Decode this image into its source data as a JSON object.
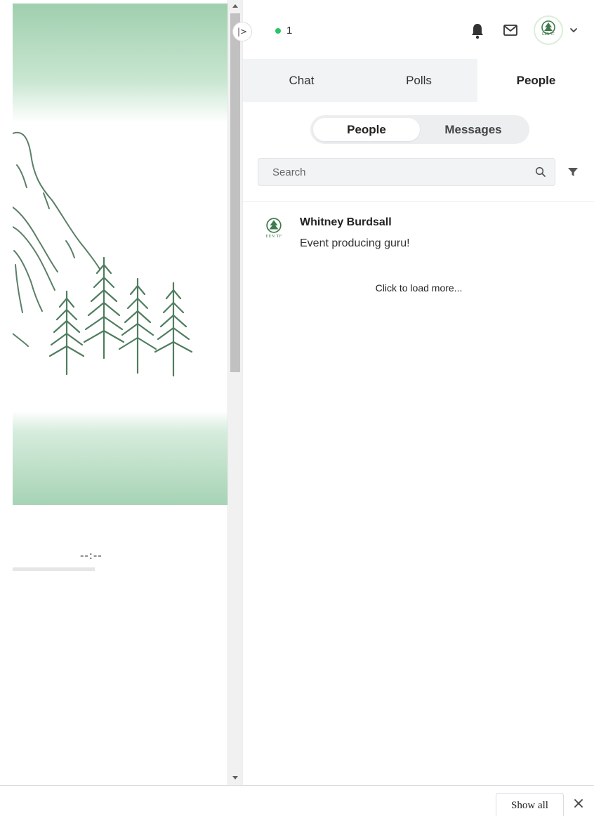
{
  "stage": {
    "timecode": "--:--"
  },
  "panel": {
    "collapse_glyph": "|>",
    "online_count": "1",
    "tabs": [
      {
        "label": "Chat",
        "active": false
      },
      {
        "label": "Polls",
        "active": false
      },
      {
        "label": "People",
        "active": true
      }
    ],
    "segments": [
      {
        "label": "People",
        "active": true
      },
      {
        "label": "Messages",
        "active": false
      }
    ],
    "search": {
      "placeholder": "Search",
      "value": ""
    },
    "people": [
      {
        "name": "Whitney Burdsall",
        "status": "Event producing guru!",
        "avatar_text": "EEN TF"
      }
    ],
    "load_more": "Click to load more...",
    "avatar_text": "EEN TF"
  },
  "bottom_bar": {
    "show_all": "Show all"
  },
  "colors": {
    "accent_green": "#9fcfae",
    "online": "#2cc36b",
    "tree": "#4f7d5e"
  },
  "icons": [
    "bell-icon",
    "mail-icon",
    "avatar-logo",
    "chevron-down-icon",
    "search-icon",
    "filter-icon",
    "close-icon"
  ]
}
